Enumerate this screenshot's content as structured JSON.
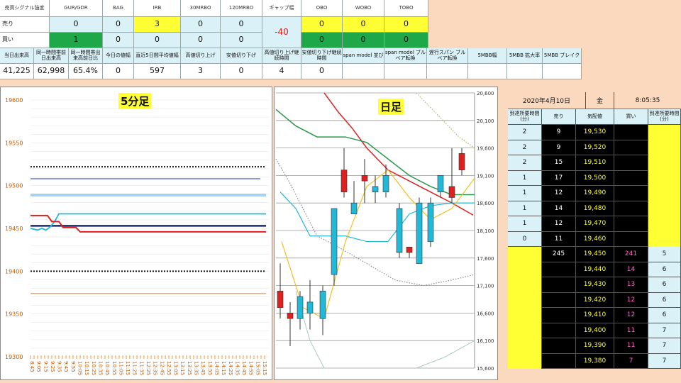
{
  "signal": {
    "corner": "売買シグナル強度",
    "headers": [
      "GUR/GDR",
      "BAG",
      "IRB",
      "30MRBO",
      "120MRBO",
      "ギャップ幅",
      "OBO",
      "WOBO",
      "TOBO"
    ],
    "sell_label": "売り",
    "buy_label": "買い",
    "sell": [
      "0",
      "0",
      "3",
      "0",
      "0",
      "",
      "0",
      "0",
      "0"
    ],
    "buy": [
      "1",
      "0",
      "0",
      "0",
      "0",
      "",
      "0",
      "0",
      "0"
    ],
    "gap": "-40"
  },
  "stats": {
    "headers": [
      "当日出来高",
      "同一時間帯前日出来高",
      "同一時間帯出来高前日比",
      "今日の値幅",
      "直近5日間平均値幅",
      "高値切り上げ",
      "安値切り下げ",
      "高値切り上げ継続時間",
      "安値切り下げ継続時間",
      "span model 並び",
      "span model ブルベア転換",
      "遅行スパン ブルベア転換",
      "5MBB幅",
      "5MBB 拡大率",
      "5MBB ブレイク"
    ],
    "values": [
      "41,225",
      "62,998",
      "65.4%",
      "0",
      "597",
      "3",
      "0",
      "4",
      "0",
      "",
      "",
      "",
      "",
      "",
      ""
    ]
  },
  "chart5": {
    "title": "5分足",
    "y_ticks": [
      "19600",
      "19550",
      "19500",
      "19450",
      "19400",
      "19350",
      "19300"
    ],
    "x_ticks": [
      "8:45",
      "9:05",
      "9:15",
      "9:25",
      "9:35",
      "9:45",
      "9:55",
      "10:05",
      "10:15",
      "10:25",
      "10:35",
      "10:45",
      "10:55",
      "11:05",
      "11:15",
      "11:25",
      "11:35",
      "12:25",
      "12:35",
      "12:45",
      "12:55",
      "13:05",
      "13:15",
      "13:25",
      "13:35",
      "13:45",
      "13:55",
      "14:05",
      "14:15",
      "14:25",
      "14:35",
      "14:45",
      "14:55",
      "15:05",
      "15:15"
    ]
  },
  "chartD": {
    "title": "日足",
    "y_ticks": [
      "20,600",
      "20,100",
      "19,600",
      "19,100",
      "18,600",
      "18,100",
      "17,600",
      "17,100",
      "16,600",
      "16,100",
      "15,600"
    ]
  },
  "board": {
    "date": "2020年4月10日",
    "weekday": "金",
    "time": "8:05:35",
    "col_headers": [
      "到達所要時間(分)",
      "売り",
      "気配値",
      "買い",
      "到達所要時間(分)"
    ],
    "rows": [
      {
        "t1": "2",
        "sell": "9",
        "price": "19,530",
        "buy": "",
        "t2": ""
      },
      {
        "t1": "2",
        "sell": "9",
        "price": "19,520",
        "buy": "",
        "t2": ""
      },
      {
        "t1": "2",
        "sell": "15",
        "price": "19,510",
        "buy": "",
        "t2": ""
      },
      {
        "t1": "1",
        "sell": "17",
        "price": "19,500",
        "buy": "",
        "t2": ""
      },
      {
        "t1": "1",
        "sell": "12",
        "price": "19,490",
        "buy": "",
        "t2": ""
      },
      {
        "t1": "1",
        "sell": "14",
        "price": "19,480",
        "buy": "",
        "t2": ""
      },
      {
        "t1": "1",
        "sell": "12",
        "price": "19,470",
        "buy": "",
        "t2": ""
      },
      {
        "t1": "0",
        "sell": "11",
        "price": "19,460",
        "buy": "",
        "t2": ""
      },
      {
        "t1": "",
        "sell": "245",
        "price": "19,450",
        "buy": "241",
        "t2": "5"
      },
      {
        "t1": "",
        "sell": "",
        "price": "19,440",
        "buy": "14",
        "t2": "6"
      },
      {
        "t1": "",
        "sell": "",
        "price": "19,430",
        "buy": "13",
        "t2": "6"
      },
      {
        "t1": "",
        "sell": "",
        "price": "19,420",
        "buy": "12",
        "t2": "6"
      },
      {
        "t1": "",
        "sell": "",
        "price": "19,410",
        "buy": "12",
        "t2": "6"
      },
      {
        "t1": "",
        "sell": "",
        "price": "19,400",
        "buy": "11",
        "t2": "7"
      },
      {
        "t1": "",
        "sell": "",
        "price": "19,390",
        "buy": "11",
        "t2": "7"
      },
      {
        "t1": "",
        "sell": "",
        "price": "19,380",
        "buy": "7",
        "t2": "7"
      }
    ]
  }
}
